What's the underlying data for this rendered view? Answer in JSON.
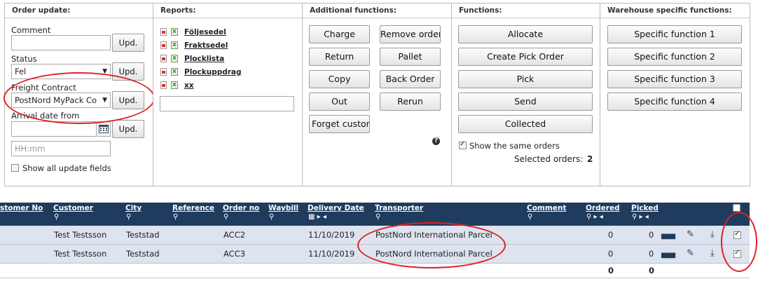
{
  "order_update": {
    "title": "Order update:",
    "comment_label": "Comment",
    "comment_value": "",
    "status_label": "Status",
    "status_value": "Fel",
    "freight_label": "Freight Contract",
    "freight_value": "PostNord MyPack Co",
    "arrival_label": "Arrival date from",
    "arrival_value": "",
    "time_placeholder": "HH:mm",
    "upd_label": "Upd.",
    "show_all_label": "Show all update fields"
  },
  "reports": {
    "title": "Reports:",
    "items": [
      "Följesedel",
      "Fraktsedel",
      "Plocklista",
      "Plockuppdrag",
      "xx"
    ]
  },
  "additional": {
    "title": "Additional functions:",
    "buttons": [
      "Charge",
      "Remove order",
      "Return",
      "Pallet",
      "Copy",
      "Back Order",
      "Out",
      "Rerun",
      "Forget custom"
    ]
  },
  "functions": {
    "title": "Functions:",
    "buttons": [
      "Allocate",
      "Create Pick Order",
      "Pick",
      "Send",
      "Collected"
    ],
    "show_same_label": "Show the same orders",
    "show_same_checked": true,
    "selected_label": "Selected orders:",
    "selected_count": "2"
  },
  "warehouse": {
    "title": "Warehouse specific functions:",
    "buttons": [
      "Specific function 1",
      "Specific function 2",
      "Specific function 3",
      "Specific function 4"
    ]
  },
  "table": {
    "headers": [
      "stomer No",
      "Customer",
      "City",
      "Reference",
      "Order no",
      "Waybill",
      "Delivery Date",
      "Transporter",
      "Comment",
      "Ordered",
      "Picked"
    ],
    "rows": [
      {
        "customer": "Test Testsson",
        "city": "Teststad",
        "order_no": "ACC2",
        "delivery_date": "11/10/2019",
        "transporter": "PostNord International Parcel",
        "ordered": "0",
        "picked": "0",
        "checked": true
      },
      {
        "customer": "Test Testsson",
        "city": "Teststad",
        "order_no": "ACC3",
        "delivery_date": "11/10/2019",
        "transporter": "PostNord International Parcel",
        "ordered": "0",
        "picked": "0",
        "checked": true
      }
    ],
    "totals": {
      "ordered": "0",
      "picked": "0"
    }
  }
}
